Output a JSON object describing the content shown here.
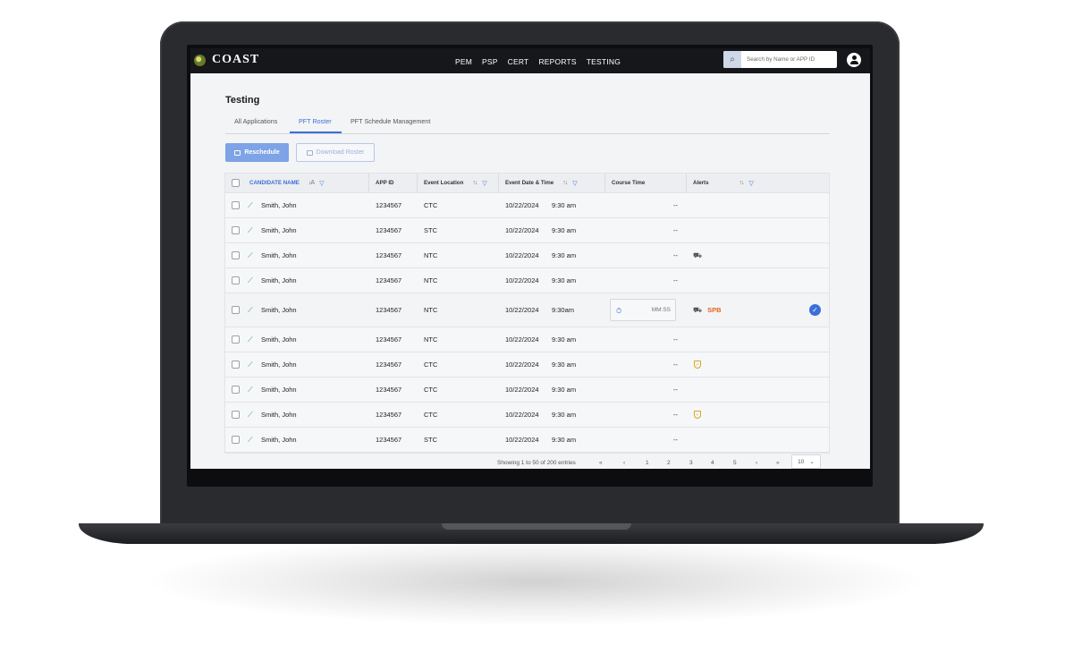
{
  "app": {
    "brand": "COAST"
  },
  "nav": {
    "links": [
      "PEM",
      "PSP",
      "CERT",
      "REPORTS",
      "TESTING"
    ]
  },
  "search": {
    "placeholder": "Search by Name or APP ID"
  },
  "page": {
    "title": "Testing"
  },
  "tabs": [
    {
      "label": "All Applications"
    },
    {
      "label": "PFT Roster",
      "active": true
    },
    {
      "label": "PFT Schedule Management"
    }
  ],
  "actions": {
    "reschedule": "Reschedule",
    "download": "Download Roster"
  },
  "table": {
    "columns": [
      "CANDIDATE NAME",
      "APP ID",
      "Event Location",
      "Event Date & Time",
      "Course Time",
      "Alerts"
    ],
    "rows": [
      {
        "name": "Smith, John",
        "app_id": "1234567",
        "location": "CTC",
        "date": "10/22/2024",
        "time": "9:30 am",
        "course": "--",
        "alert": ""
      },
      {
        "name": "Smith, John",
        "app_id": "1234567",
        "location": "STC",
        "date": "10/22/2024",
        "time": "9:30 am",
        "course": "--",
        "alert": ""
      },
      {
        "name": "Smith, John",
        "app_id": "1234567",
        "location": "NTC",
        "date": "10/22/2024",
        "time": "9:30 am",
        "course": "--",
        "alert": "truck-icon"
      },
      {
        "name": "Smith, John",
        "app_id": "1234567",
        "location": "NTC",
        "date": "10/22/2024",
        "time": "9:30 am",
        "course": "--",
        "alert": ""
      },
      {
        "name": "Smith, John",
        "app_id": "1234567",
        "location": "NTC",
        "date": "10/22/2024",
        "time": "9:30am",
        "course_placeholder": "MM:SS",
        "alert": "truck-icon",
        "alert_label": "SPB",
        "confirmed": true
      },
      {
        "name": "Smith, John",
        "app_id": "1234567",
        "location": "NTC",
        "date": "10/22/2024",
        "time": "9:30 am",
        "course": "--",
        "alert": ""
      },
      {
        "name": "Smith, John",
        "app_id": "1234567",
        "location": "CTC",
        "date": "10/22/2024",
        "time": "9:30 am",
        "course": "--",
        "alert": "shield-icon"
      },
      {
        "name": "Smith, John",
        "app_id": "1234567",
        "location": "CTC",
        "date": "10/22/2024",
        "time": "9:30 am",
        "course": "--",
        "alert": ""
      },
      {
        "name": "Smith, John",
        "app_id": "1234567",
        "location": "CTC",
        "date": "10/22/2024",
        "time": "9:30 am",
        "course": "--",
        "alert": "shield-icon"
      },
      {
        "name": "Smith, John",
        "app_id": "1234567",
        "location": "STC",
        "date": "10/22/2024",
        "time": "9:30 am",
        "course": "--",
        "alert": ""
      }
    ]
  },
  "pagination": {
    "info": "Showing 1 to 50 of 200 entries",
    "first": "«",
    "prev": "‹",
    "pages": [
      "1",
      "2",
      "3",
      "4",
      "5"
    ],
    "next": "›",
    "last": "»",
    "page_size": "10"
  },
  "colors": {
    "accent": "#3b6fd8",
    "nav_bg": "#16171a",
    "trend": "#1f9d55",
    "spb": "#e0691f",
    "shield": "#d7a520"
  }
}
